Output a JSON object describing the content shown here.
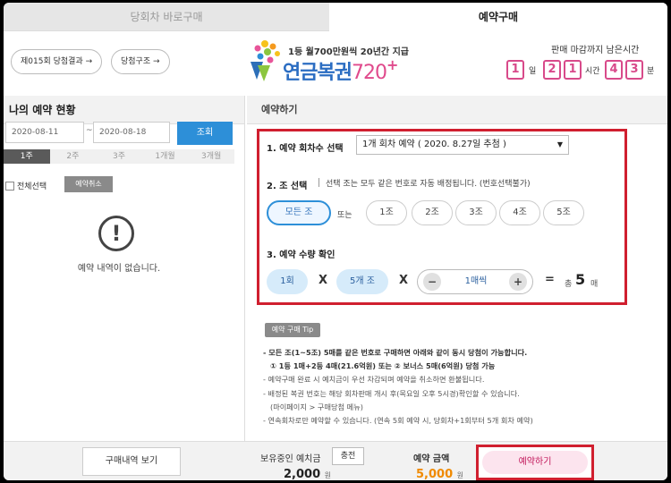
{
  "tabs": {
    "left": "당회차 바로구매",
    "right": "예약구매"
  },
  "header": {
    "results_button": "제015회 당첨결과 →",
    "structure_button": "당첨구조 →",
    "logo_tagline": "1등 월700만원씩 20년간 지급",
    "logo_name": "연금복권",
    "logo_number": "720",
    "logo_plus": "+",
    "deadline_title": "판매 마감까지 남은시간",
    "countdown": {
      "day": "1",
      "day_unit": "일",
      "hour_tens": "2",
      "hour_ones": "1",
      "hour_unit": "시간",
      "min_tens": "4",
      "min_ones": "3",
      "min_unit": "분"
    }
  },
  "left_panel": {
    "title": "나의 예약 현황",
    "date_from": "2020-08-11",
    "date_sep": "~",
    "date_to": "2020-08-18",
    "search_button": "조회",
    "periods": [
      "1주",
      "2주",
      "3주",
      "1개월",
      "3개월"
    ],
    "active_period": 0,
    "select_all": "전체선택",
    "cancel_button": "예약취소",
    "empty_icon": "!",
    "empty_message": "예약 내역이 없습니다."
  },
  "right_panel": {
    "title": "예약하기",
    "step1_label": "1. 예약 회차수 선택",
    "round_select_value": "1개 회차 예약 ( 2020. 8.27일 추첨 )",
    "step2_label": "2. 조 선택",
    "step2_note": "선택 조는 모두 같은 번호로 자동 배정됩니다. (번호선택불가)",
    "jo_options": [
      "모든 조",
      "1조",
      "2조",
      "3조",
      "4조",
      "5조"
    ],
    "or_text": "또는",
    "step3_label": "3. 예약 수량 확인",
    "qty_rounds": "1회",
    "times_sign": "X",
    "qty_jo": "5개 조",
    "minus": "−",
    "per_sheet": "1매씩",
    "plus": "+",
    "equals": "=",
    "total_prefix": "총",
    "total_count": "5",
    "total_unit": "매"
  },
  "tips": {
    "badge": "예약 구매 Tip",
    "lines": [
      "- 모든 조(1~5조) 5매를 같은 번호로 구매하면 아래와 같이 동시 당첨이 가능합니다.",
      "① 1등 1매+2등 4매(21.6억원) 또는 ② 보너스 5매(6억원) 당첨 가능",
      "- 예약구매 완료 시 예치금이 우선 차감되며 예약을 취소하면 환불됩니다.",
      "- 배정된 복권 번호는 해당 회차판매 개시 후(목요일 오후 5시경)확인할 수 있습니다.",
      "(마이페이지 > 구매당첨 메뉴)",
      "- 연속회차로만 예약할 수 있습니다. (연속 5회 예약 시, 당회차+1회부터 5개 회차 예약)"
    ]
  },
  "bottom": {
    "history_button": "구매내역 보기",
    "balance_label": "보유중인 예치금",
    "charge_button": "충전",
    "balance_value": "2,000",
    "won": "원",
    "amount_label": "예약 금액",
    "amount_value": "5,000",
    "reserve_button": "예약하기"
  },
  "colors": {
    "accent_blue": "#2d8fd8",
    "pink": "#d84a8a",
    "highlight_red": "#d01f2f",
    "amount_orange": "#f08a00"
  }
}
